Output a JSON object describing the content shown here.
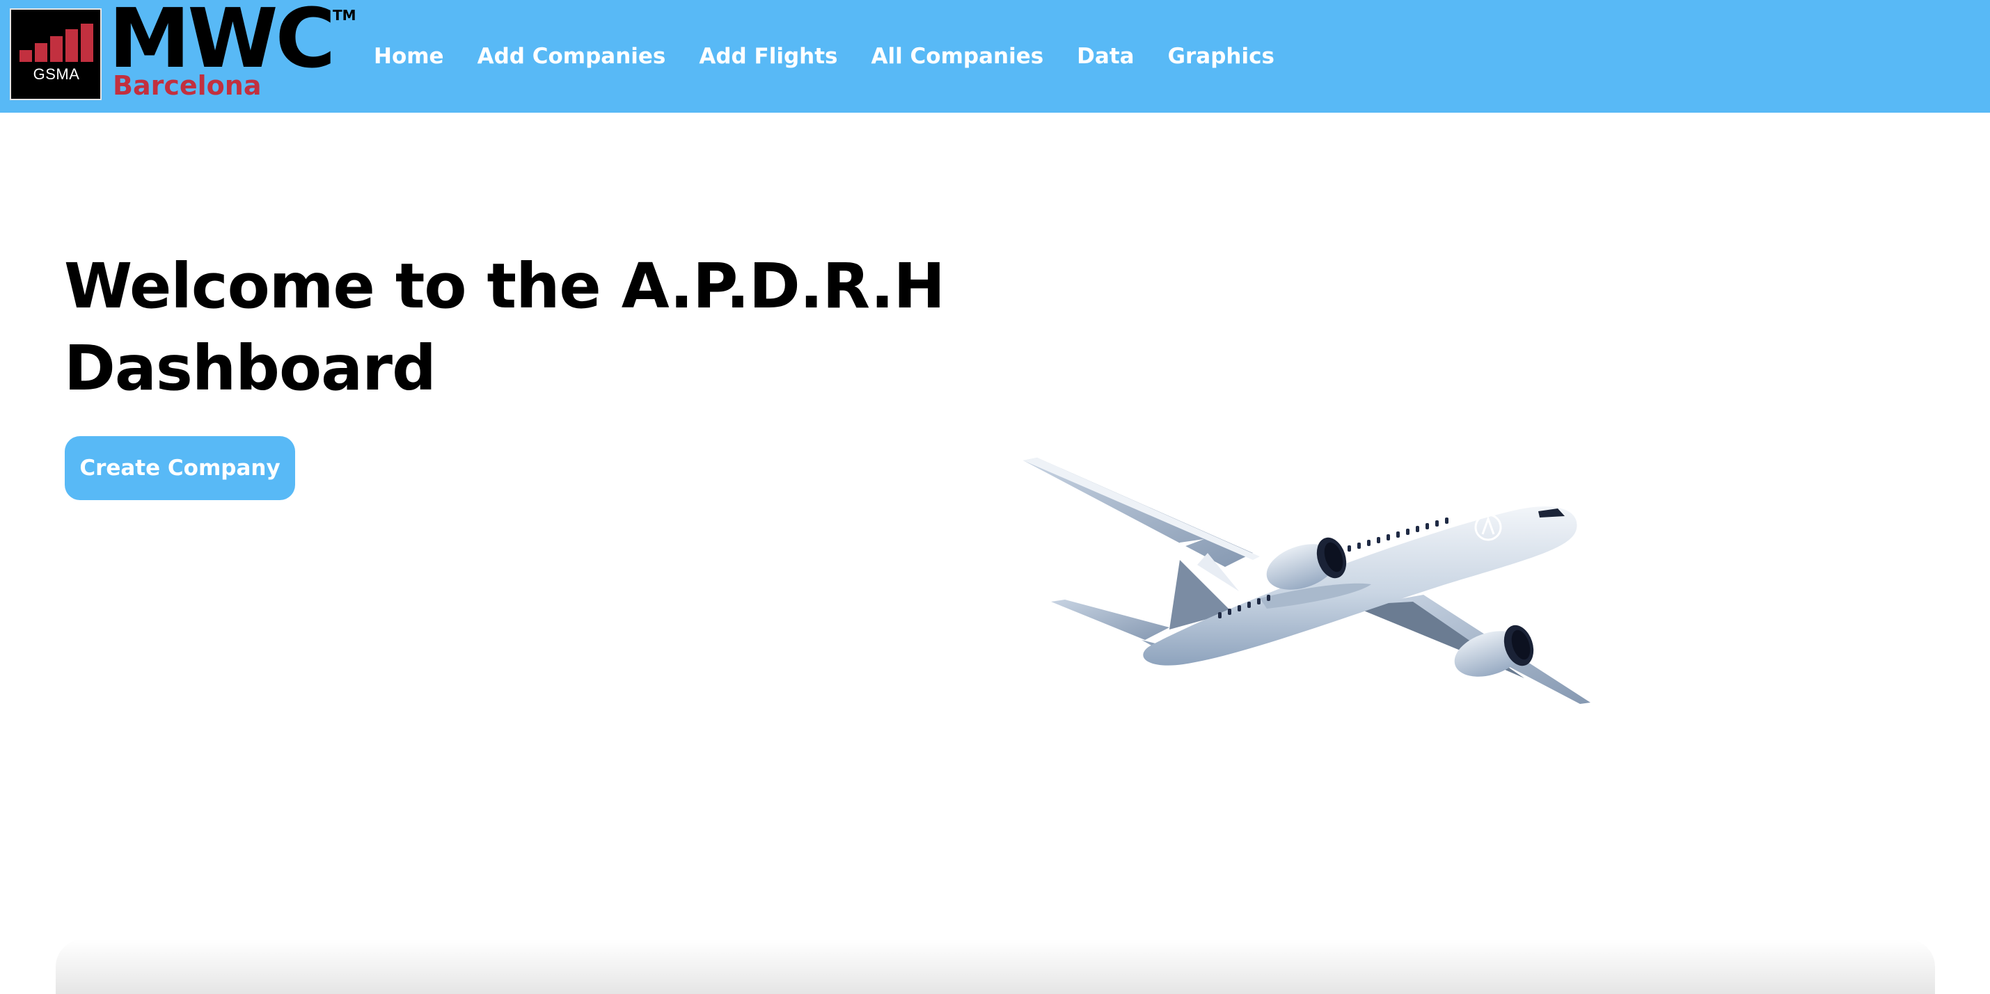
{
  "brand": {
    "org": "GSMA",
    "name": "MWC",
    "trademark": "TM",
    "city": "Barcelona",
    "logo_bg": "#000000",
    "logo_bars_color": "#c2303f",
    "city_color": "#c2303f"
  },
  "nav": {
    "background": "#58b9f6",
    "items": [
      {
        "label": "Home"
      },
      {
        "label": "Add Companies"
      },
      {
        "label": "Add Flights"
      },
      {
        "label": "All Companies"
      },
      {
        "label": "Data"
      },
      {
        "label": "Graphics"
      }
    ]
  },
  "hero": {
    "title_line1": "Welcome to the A.P.D.R.H",
    "title_line2": "Dashboard",
    "cta_label": "Create Company",
    "cta_color": "#58b9f6"
  },
  "illustration": {
    "icon": "airplane-illustration",
    "tail_logo": "A"
  }
}
